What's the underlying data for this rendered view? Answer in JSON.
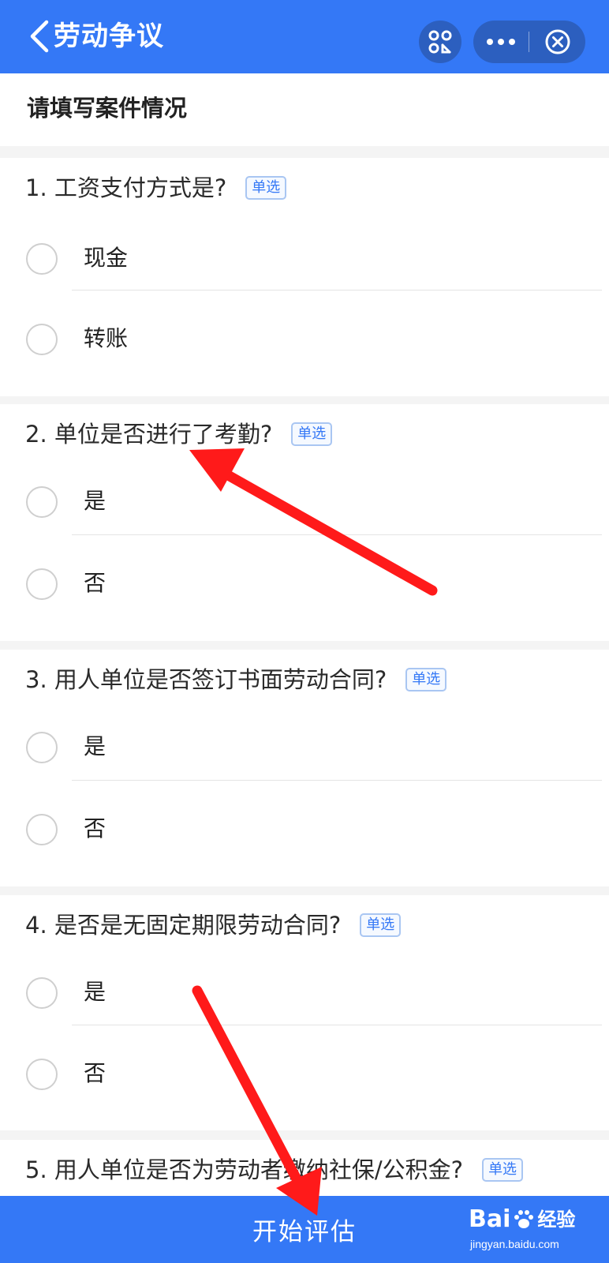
{
  "header": {
    "title": "劳动争议",
    "colors": {
      "bar": "#3478f6",
      "capsule": "#2c5fbf"
    }
  },
  "form": {
    "heading": "请填写案件情况",
    "questions": [
      {
        "title": "1. 工资支付方式是?",
        "badge": "单选",
        "options": [
          "现金",
          "转账"
        ]
      },
      {
        "title": "2. 单位是否进行了考勤?",
        "badge": "单选",
        "options": [
          "是",
          "否"
        ]
      },
      {
        "title": "3. 用人单位是否签订书面劳动合同?",
        "badge": "单选",
        "options": [
          "是",
          "否"
        ]
      },
      {
        "title": "4. 是否是无固定期限劳动合同?",
        "badge": "单选",
        "options": [
          "是",
          "否"
        ]
      },
      {
        "title": "5. 用人单位是否为劳动者缴纳社保/公积金?",
        "badge": "单选",
        "options": []
      }
    ]
  },
  "footer": {
    "button_label": "开始评估"
  },
  "watermark": {
    "brand_prefix": "Bai",
    "brand_suffix": "经验",
    "url": "jingyan.baidu.com"
  },
  "annotation_color": "#ff1a1a"
}
